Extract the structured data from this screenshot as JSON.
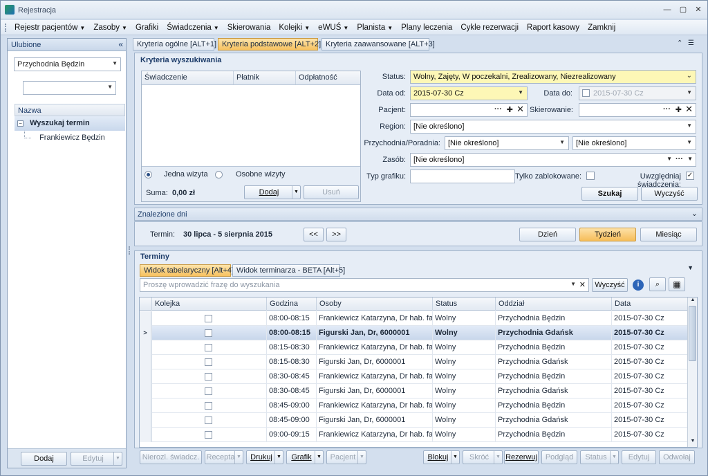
{
  "window": {
    "title": "Rejestracja"
  },
  "menu": [
    {
      "label": "Rejestr pacjentów",
      "dd": true
    },
    {
      "label": "Zasoby",
      "dd": true
    },
    {
      "label": "Grafiki",
      "dd": false
    },
    {
      "label": "Świadczenia",
      "dd": true
    },
    {
      "label": "Skierowania",
      "dd": false
    },
    {
      "label": "Kolejki",
      "dd": true
    },
    {
      "label": "eWUŚ",
      "dd": true
    },
    {
      "label": "Planista",
      "dd": true
    },
    {
      "label": "Plany leczenia",
      "dd": false
    },
    {
      "label": "Cykle rezerwacji",
      "dd": false
    },
    {
      "label": "Raport kasowy",
      "dd": false
    },
    {
      "label": "Zamknij",
      "dd": false
    }
  ],
  "favorites": {
    "title": "Ulubione",
    "clinic": "Przychodnia Będzin",
    "filter": "",
    "column": "Nazwa",
    "items": [
      {
        "label": "Wyszukaj termin"
      },
      {
        "label": "Frankiewicz Będzin"
      }
    ],
    "add": "Dodaj",
    "edit": "Edytuj"
  },
  "tabs": [
    "Kryteria ogólne [ALT+1]",
    "Kryteria podstawowe [ALT+2]",
    "Kryteria zaawansowane [ALT+3]"
  ],
  "criteria": {
    "title": "Kryteria wyszukiwania",
    "table_cols": [
      "Świadczenie",
      "Płatnik",
      "Odpłatność"
    ],
    "single_visit": "Jedna wizyta",
    "separate_visits": "Osobne wizyty",
    "sum_label": "Suma:",
    "sum_value": "0,00 zł",
    "add": "Dodaj",
    "remove": "Usuń",
    "status_label": "Status:",
    "status_value": "Wolny, Zajęty, W poczekalni, Zrealizowany, Niezrealizowany",
    "date_from_label": "Data od:",
    "date_from": "2015-07-30 Cz",
    "date_to_label": "Data do:",
    "date_to": "2015-07-30 Cz",
    "patient_label": "Pacjent:",
    "patient": "",
    "referral_label": "Skierowanie:",
    "referral": "",
    "region_label": "Region:",
    "region": "[Nie określono]",
    "clinic_label": "Przychodnia/Poradnia:",
    "clinic": "[Nie określono]",
    "clinic2": "[Nie określono]",
    "resource_label": "Zasób:",
    "resource": "[Nie określono]",
    "schedule_label": "Typ grafiku:",
    "schedule": "",
    "blocked_label": "Tylko zablokowane:",
    "services_label": "Uwzględniaj świadczenia:",
    "search": "Szukaj",
    "clear": "Wyczyść"
  },
  "found": {
    "title": "Znalezione dni",
    "term_label": "Termin:",
    "term_value": "30 lipca - 5 sierpnia 2015",
    "prev": "<<",
    "next": ">>",
    "day": "Dzień",
    "week": "Tydzień",
    "month": "Miesiąc"
  },
  "terms": {
    "title": "Terminy",
    "tab_table": "Widok tabelaryczny [Alt+4]",
    "tab_cal": "Widok terminarza - BETA [Alt+5]",
    "search_placeholder": "Proszę wprowadzić frazę do wyszukania",
    "clear": "Wyczyść",
    "columns": [
      "Kolejka",
      "Godzina",
      "Osoby",
      "Status",
      "Oddział",
      "Data"
    ],
    "rows": [
      {
        "time": "08:00-08:15",
        "person": "Frankiewicz Katarzyna, Dr hab. fa...",
        "status": "Wolny",
        "dept": "Przychodnia Będzin",
        "date": "2015-07-30 Cz",
        "sel": false
      },
      {
        "time": "08:00-08:15",
        "person": "Figurski Jan, Dr, 6000001",
        "status": "Wolny",
        "dept": "Przychodnia Gdańsk",
        "date": "2015-07-30 Cz",
        "sel": true
      },
      {
        "time": "08:15-08:30",
        "person": "Frankiewicz Katarzyna, Dr hab. fa...",
        "status": "Wolny",
        "dept": "Przychodnia Będzin",
        "date": "2015-07-30 Cz",
        "sel": false
      },
      {
        "time": "08:15-08:30",
        "person": "Figurski Jan, Dr, 6000001",
        "status": "Wolny",
        "dept": "Przychodnia Gdańsk",
        "date": "2015-07-30 Cz",
        "sel": false
      },
      {
        "time": "08:30-08:45",
        "person": "Frankiewicz Katarzyna, Dr hab. fa...",
        "status": "Wolny",
        "dept": "Przychodnia Będzin",
        "date": "2015-07-30 Cz",
        "sel": false
      },
      {
        "time": "08:30-08:45",
        "person": "Figurski Jan, Dr, 6000001",
        "status": "Wolny",
        "dept": "Przychodnia Gdańsk",
        "date": "2015-07-30 Cz",
        "sel": false
      },
      {
        "time": "08:45-09:00",
        "person": "Frankiewicz Katarzyna, Dr hab. fa...",
        "status": "Wolny",
        "dept": "Przychodnia Będzin",
        "date": "2015-07-30 Cz",
        "sel": false
      },
      {
        "time": "08:45-09:00",
        "person": "Figurski Jan, Dr, 6000001",
        "status": "Wolny",
        "dept": "Przychodnia Gdańsk",
        "date": "2015-07-30 Cz",
        "sel": false
      },
      {
        "time": "09:00-09:15",
        "person": "Frankiewicz Katarzyna, Dr hab. fa...",
        "status": "Wolny",
        "dept": "Przychodnia Będzin",
        "date": "2015-07-30 Cz",
        "sel": false
      }
    ]
  },
  "bottom": [
    {
      "label": "Nierozl. świadcz.",
      "dis": true,
      "dd": false
    },
    {
      "label": "Recepta",
      "dis": true,
      "dd": true
    },
    {
      "label": "Drukuj",
      "dis": false,
      "dd": true
    },
    {
      "label": "Grafik",
      "dis": false,
      "dd": true
    },
    {
      "label": "Pacjent",
      "dis": true,
      "dd": true
    },
    {
      "label": "Blokuj",
      "dis": false,
      "dd": true
    },
    {
      "label": "Skróć",
      "dis": true,
      "dd": true
    },
    {
      "label": "Rezerwuj",
      "dis": false,
      "dd": false
    },
    {
      "label": "Podgląd",
      "dis": true,
      "dd": false
    },
    {
      "label": "Status",
      "dis": true,
      "dd": true
    },
    {
      "label": "Edytuj",
      "dis": true,
      "dd": false
    },
    {
      "label": "Odwołaj",
      "dis": true,
      "dd": false
    }
  ]
}
